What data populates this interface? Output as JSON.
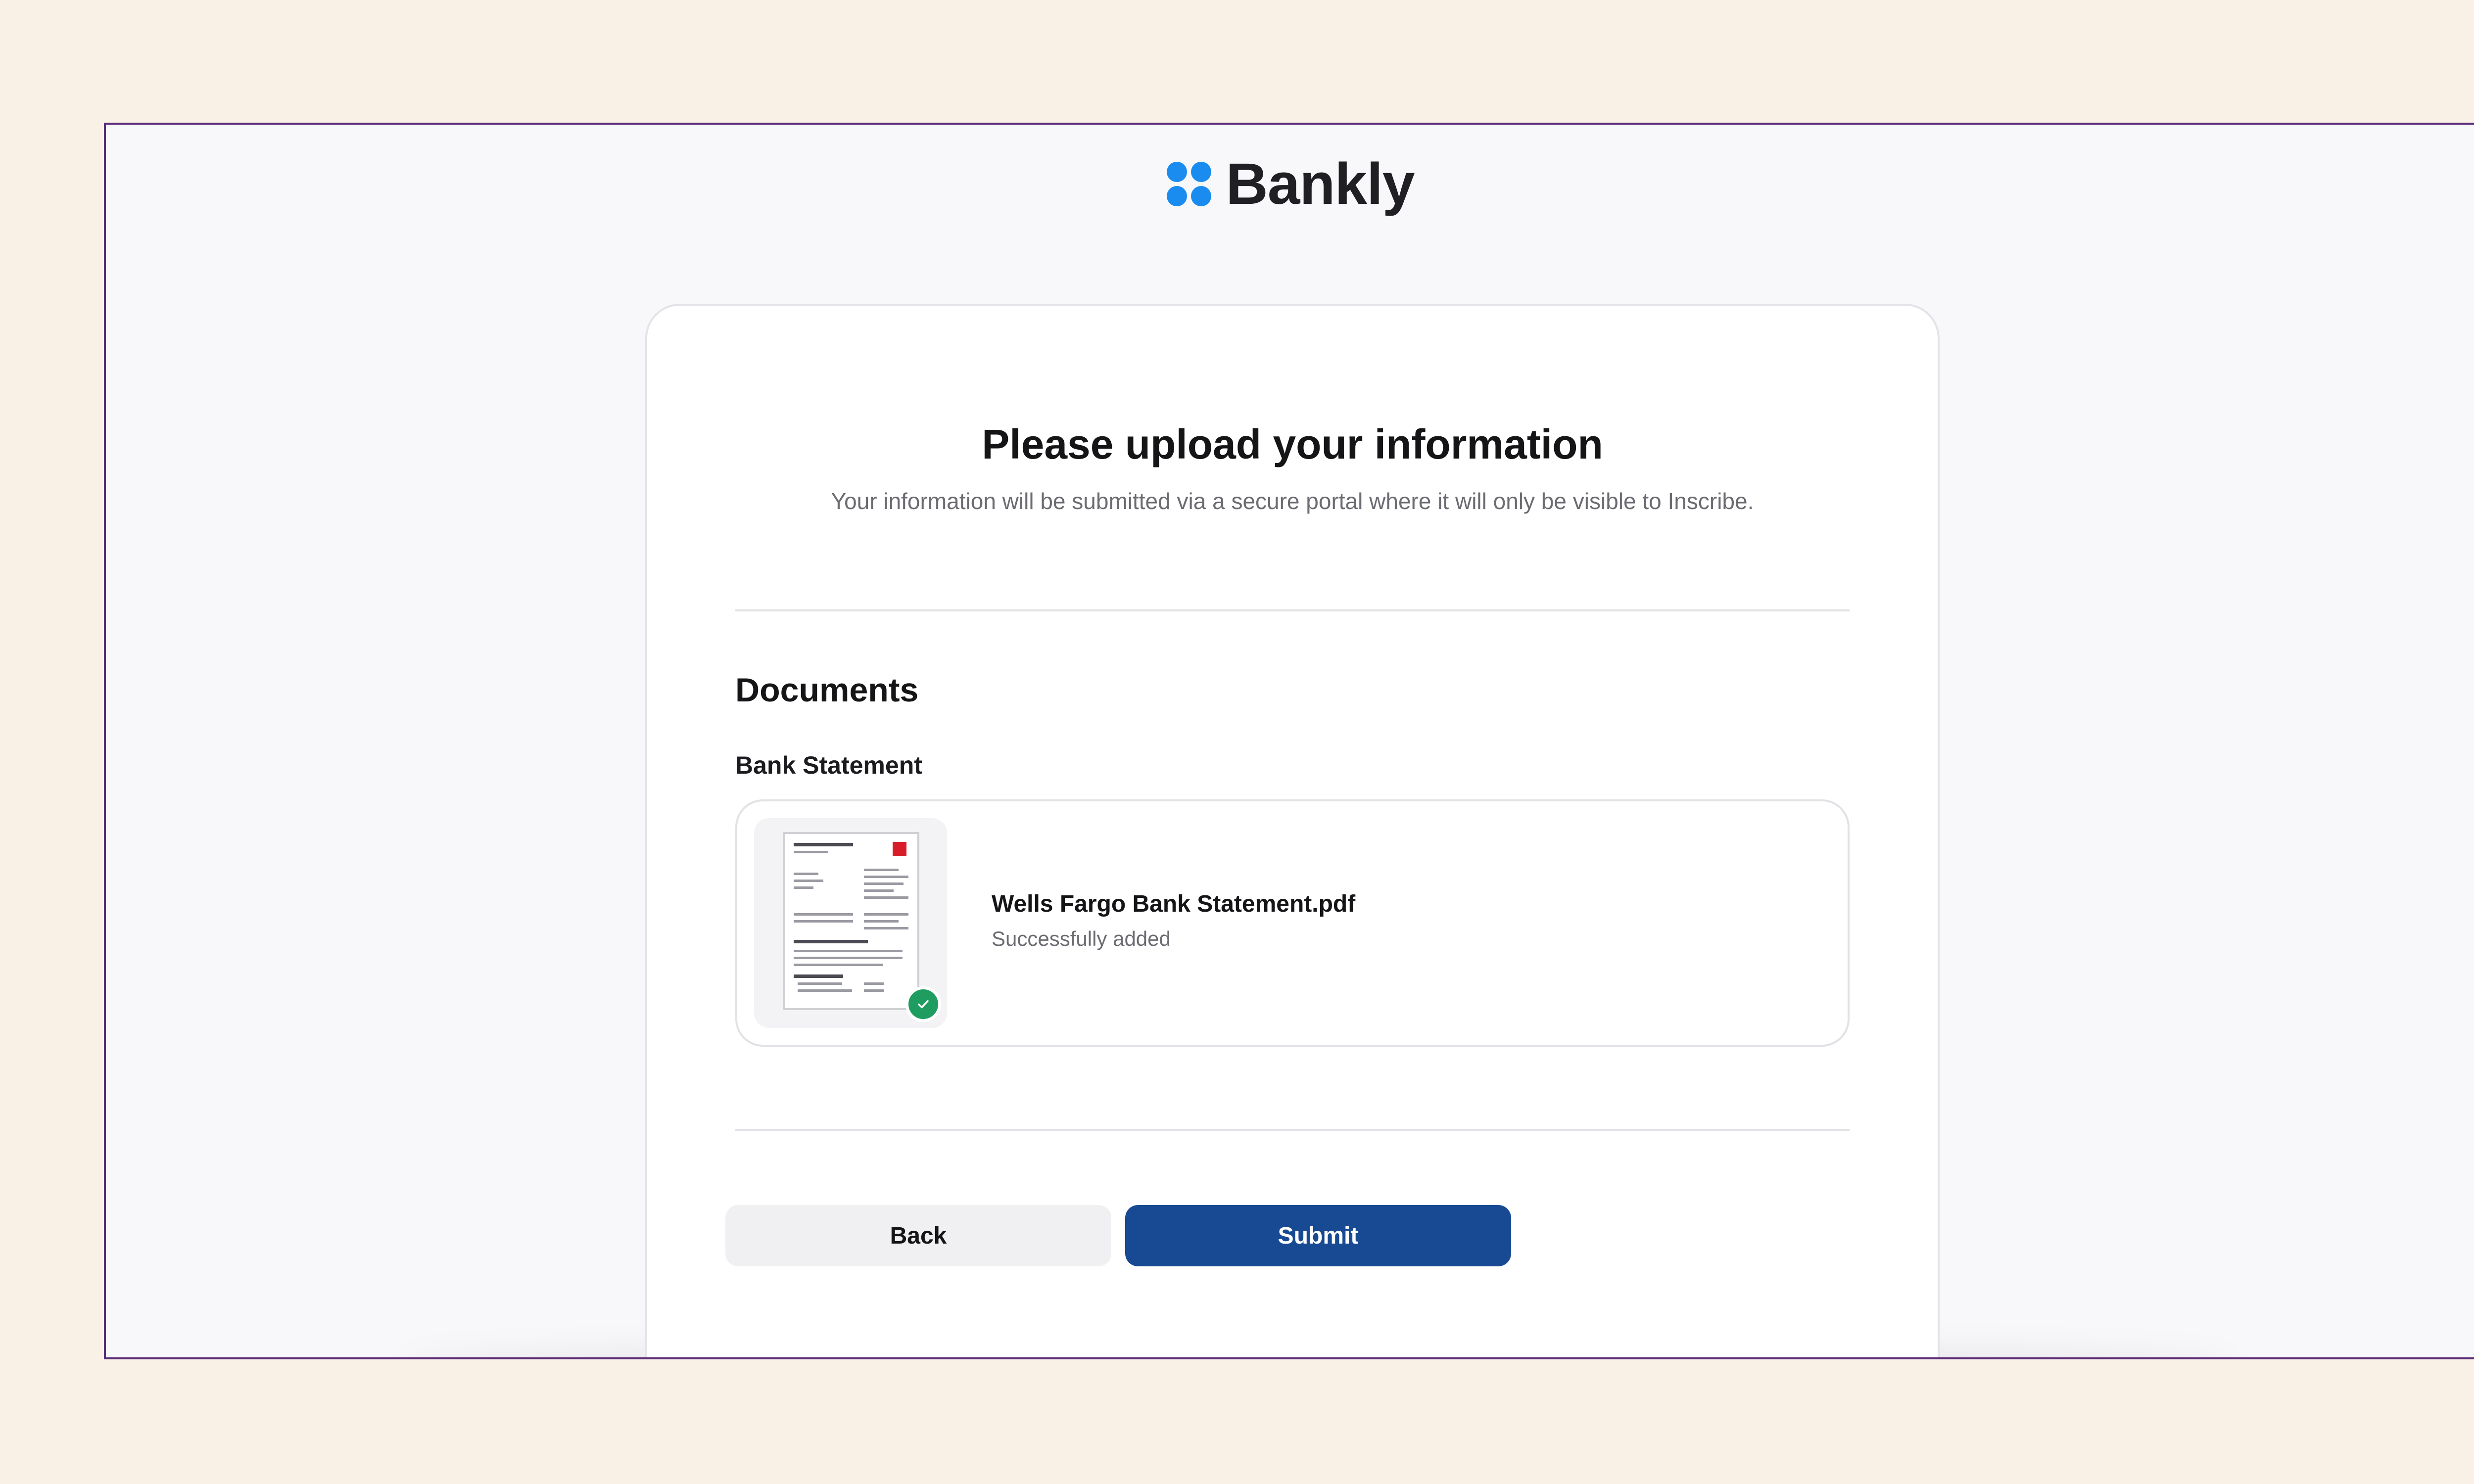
{
  "brand": {
    "name": "Bankly",
    "logo_icon": "four-dots-logo-icon",
    "accent_color": "#1a8cf0"
  },
  "upload": {
    "title": "Please upload your information",
    "subtitle": "Your information will be submitted via a secure portal where it will only be visible to Inscribe."
  },
  "documents": {
    "section_title": "Documents",
    "field_label": "Bank Statement",
    "file": {
      "name": "Wells Fargo Bank Statement.pdf",
      "status": "Successfully added",
      "status_icon": "check-icon",
      "status_color": "#1f9d60"
    }
  },
  "actions": {
    "back_label": "Back",
    "submit_label": "Submit",
    "submit_color": "#174a92"
  }
}
